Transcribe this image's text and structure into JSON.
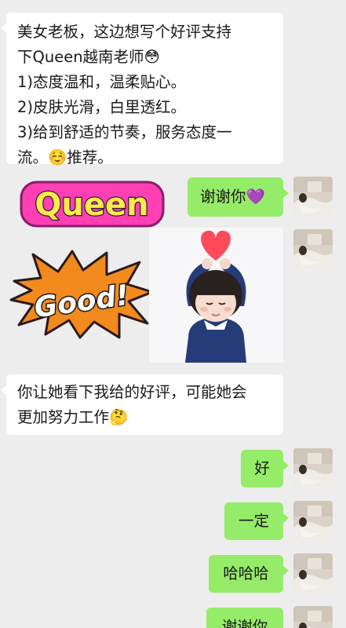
{
  "messages": {
    "review": {
      "lines": [
        "美女老板，这边想写个好评支持",
        "下Queen越南老师😳",
        "1)态度温和，温柔贴心。",
        "2)皮肤光滑，白里透红。",
        "3)给到舒适的节奏，服务态度一",
        "流。☺️推荐。"
      ]
    },
    "thanks_purple": "谢谢你💜",
    "sticker": {
      "queen_text": "Queen",
      "good_text": "Good!"
    },
    "reply_lines": [
      "你让她看下我给的好评，可能她会",
      "更加努力工作🤔"
    ],
    "ok": "好",
    "sure": "一定",
    "haha": "哈哈哈",
    "thanks_partial": "谢谢你"
  },
  "colors": {
    "background": "#ededed",
    "incoming_bubble": "#ffffff",
    "outgoing_bubble": "#95ec69"
  }
}
